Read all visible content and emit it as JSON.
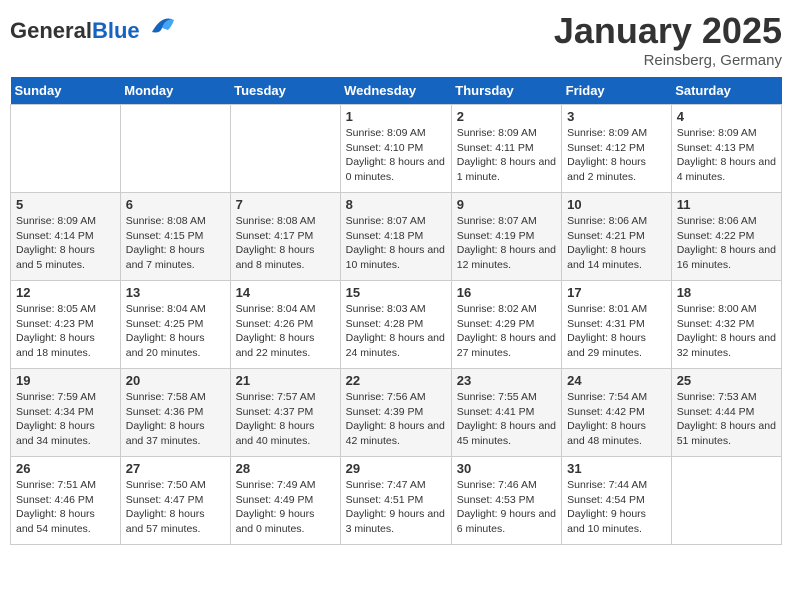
{
  "header": {
    "logo_general": "General",
    "logo_blue": "Blue",
    "cal_title": "January 2025",
    "cal_subtitle": "Reinsberg, Germany"
  },
  "days_of_week": [
    "Sunday",
    "Monday",
    "Tuesday",
    "Wednesday",
    "Thursday",
    "Friday",
    "Saturday"
  ],
  "weeks": [
    [
      {
        "day": "",
        "info": ""
      },
      {
        "day": "",
        "info": ""
      },
      {
        "day": "",
        "info": ""
      },
      {
        "day": "1",
        "info": "Sunrise: 8:09 AM\nSunset: 4:10 PM\nDaylight: 8 hours and 0 minutes."
      },
      {
        "day": "2",
        "info": "Sunrise: 8:09 AM\nSunset: 4:11 PM\nDaylight: 8 hours and 1 minute."
      },
      {
        "day": "3",
        "info": "Sunrise: 8:09 AM\nSunset: 4:12 PM\nDaylight: 8 hours and 2 minutes."
      },
      {
        "day": "4",
        "info": "Sunrise: 8:09 AM\nSunset: 4:13 PM\nDaylight: 8 hours and 4 minutes."
      }
    ],
    [
      {
        "day": "5",
        "info": "Sunrise: 8:09 AM\nSunset: 4:14 PM\nDaylight: 8 hours and 5 minutes."
      },
      {
        "day": "6",
        "info": "Sunrise: 8:08 AM\nSunset: 4:15 PM\nDaylight: 8 hours and 7 minutes."
      },
      {
        "day": "7",
        "info": "Sunrise: 8:08 AM\nSunset: 4:17 PM\nDaylight: 8 hours and 8 minutes."
      },
      {
        "day": "8",
        "info": "Sunrise: 8:07 AM\nSunset: 4:18 PM\nDaylight: 8 hours and 10 minutes."
      },
      {
        "day": "9",
        "info": "Sunrise: 8:07 AM\nSunset: 4:19 PM\nDaylight: 8 hours and 12 minutes."
      },
      {
        "day": "10",
        "info": "Sunrise: 8:06 AM\nSunset: 4:21 PM\nDaylight: 8 hours and 14 minutes."
      },
      {
        "day": "11",
        "info": "Sunrise: 8:06 AM\nSunset: 4:22 PM\nDaylight: 8 hours and 16 minutes."
      }
    ],
    [
      {
        "day": "12",
        "info": "Sunrise: 8:05 AM\nSunset: 4:23 PM\nDaylight: 8 hours and 18 minutes."
      },
      {
        "day": "13",
        "info": "Sunrise: 8:04 AM\nSunset: 4:25 PM\nDaylight: 8 hours and 20 minutes."
      },
      {
        "day": "14",
        "info": "Sunrise: 8:04 AM\nSunset: 4:26 PM\nDaylight: 8 hours and 22 minutes."
      },
      {
        "day": "15",
        "info": "Sunrise: 8:03 AM\nSunset: 4:28 PM\nDaylight: 8 hours and 24 minutes."
      },
      {
        "day": "16",
        "info": "Sunrise: 8:02 AM\nSunset: 4:29 PM\nDaylight: 8 hours and 27 minutes."
      },
      {
        "day": "17",
        "info": "Sunrise: 8:01 AM\nSunset: 4:31 PM\nDaylight: 8 hours and 29 minutes."
      },
      {
        "day": "18",
        "info": "Sunrise: 8:00 AM\nSunset: 4:32 PM\nDaylight: 8 hours and 32 minutes."
      }
    ],
    [
      {
        "day": "19",
        "info": "Sunrise: 7:59 AM\nSunset: 4:34 PM\nDaylight: 8 hours and 34 minutes."
      },
      {
        "day": "20",
        "info": "Sunrise: 7:58 AM\nSunset: 4:36 PM\nDaylight: 8 hours and 37 minutes."
      },
      {
        "day": "21",
        "info": "Sunrise: 7:57 AM\nSunset: 4:37 PM\nDaylight: 8 hours and 40 minutes."
      },
      {
        "day": "22",
        "info": "Sunrise: 7:56 AM\nSunset: 4:39 PM\nDaylight: 8 hours and 42 minutes."
      },
      {
        "day": "23",
        "info": "Sunrise: 7:55 AM\nSunset: 4:41 PM\nDaylight: 8 hours and 45 minutes."
      },
      {
        "day": "24",
        "info": "Sunrise: 7:54 AM\nSunset: 4:42 PM\nDaylight: 8 hours and 48 minutes."
      },
      {
        "day": "25",
        "info": "Sunrise: 7:53 AM\nSunset: 4:44 PM\nDaylight: 8 hours and 51 minutes."
      }
    ],
    [
      {
        "day": "26",
        "info": "Sunrise: 7:51 AM\nSunset: 4:46 PM\nDaylight: 8 hours and 54 minutes."
      },
      {
        "day": "27",
        "info": "Sunrise: 7:50 AM\nSunset: 4:47 PM\nDaylight: 8 hours and 57 minutes."
      },
      {
        "day": "28",
        "info": "Sunrise: 7:49 AM\nSunset: 4:49 PM\nDaylight: 9 hours and 0 minutes."
      },
      {
        "day": "29",
        "info": "Sunrise: 7:47 AM\nSunset: 4:51 PM\nDaylight: 9 hours and 3 minutes."
      },
      {
        "day": "30",
        "info": "Sunrise: 7:46 AM\nSunset: 4:53 PM\nDaylight: 9 hours and 6 minutes."
      },
      {
        "day": "31",
        "info": "Sunrise: 7:44 AM\nSunset: 4:54 PM\nDaylight: 9 hours and 10 minutes."
      },
      {
        "day": "",
        "info": ""
      }
    ]
  ]
}
